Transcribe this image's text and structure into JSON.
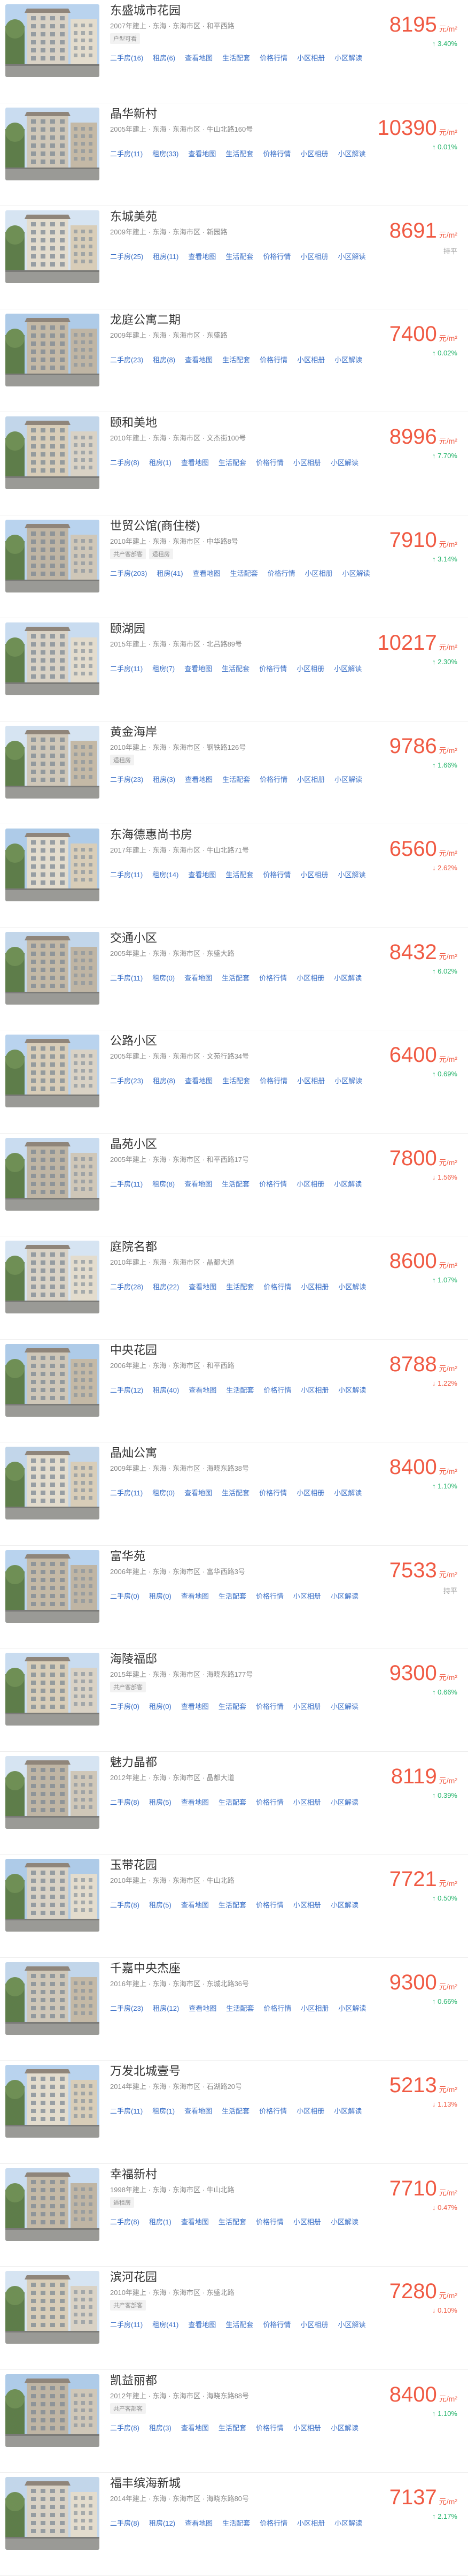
{
  "price_unit": "元/m²",
  "links": [
    "二手房",
    "租房",
    "查看地图",
    "生活配套",
    "价格行情",
    "小区相册",
    "小区解读"
  ],
  "items": [
    {
      "name": "东盛城市花园",
      "meta": "2007年建上 · 东海 · 东海市区 · 和平西路",
      "tags": [
        "户型可看"
      ],
      "sale": "16",
      "rent": "6",
      "price": "8195",
      "change": "↑ 3.40%",
      "dir": "up"
    },
    {
      "name": "晶华新村",
      "meta": "2005年建上 · 东海 · 东海市区 · 牛山北路160号",
      "tags": [],
      "sale": "11",
      "rent": "33",
      "price": "10390",
      "change": "↑ 0.01%",
      "dir": "up"
    },
    {
      "name": "东城美苑",
      "meta": "2009年建上 · 东海 · 东海市区 · 新园路",
      "tags": [],
      "sale": "25",
      "rent": "11",
      "price": "8691",
      "change": "持平",
      "dir": "flat"
    },
    {
      "name": "龙庭公寓二期",
      "meta": "2009年建上 · 东海 · 东海市区 · 东盛路",
      "tags": [],
      "sale": "23",
      "rent": "8",
      "price": "7400",
      "change": "↑ 0.02%",
      "dir": "up"
    },
    {
      "name": "颐和美地",
      "meta": "2010年建上 · 东海 · 东海市区 · 文杰街100号",
      "tags": [],
      "sale": "8",
      "rent": "1",
      "price": "8996",
      "change": "↑ 7.70%",
      "dir": "up"
    },
    {
      "name": "世贸公馆(商住楼)",
      "meta": "2010年建上 · 东海 · 东海市区 · 中华路8号",
      "tags": [
        "共产客部客",
        "适租房"
      ],
      "sale": "203",
      "rent": "41",
      "price": "7910",
      "change": "↑ 3.14%",
      "dir": "up"
    },
    {
      "name": "颐湖园",
      "meta": "2015年建上 · 东海 · 东海市区 · 北吕路89号",
      "tags": [],
      "sale": "11",
      "rent": "7",
      "price": "10217",
      "change": "↑ 2.30%",
      "dir": "up"
    },
    {
      "name": "黄金海岸",
      "meta": "2010年建上 · 东海 · 东海市区 · 钢铁路126号",
      "tags": [
        "适租房"
      ],
      "sale": "23",
      "rent": "3",
      "price": "9786",
      "change": "↑ 1.66%",
      "dir": "up"
    },
    {
      "name": "东海德惠尚书房",
      "meta": "2017年建上 · 东海 · 东海市区 · 牛山北路71号",
      "tags": [],
      "sale": "11",
      "rent": "14",
      "price": "6560",
      "change": "↓ 2.62%",
      "dir": "down"
    },
    {
      "name": "交通小区",
      "meta": "2005年建上 · 东海 · 东海市区 · 东盛大路",
      "tags": [],
      "sale": "11",
      "rent": "0",
      "price": "8432",
      "change": "↑ 6.02%",
      "dir": "up"
    },
    {
      "name": "公路小区",
      "meta": "2005年建上 · 东海 · 东海市区 · 文苑行路34号",
      "tags": [],
      "sale": "23",
      "rent": "8",
      "price": "6400",
      "change": "↑ 0.69%",
      "dir": "up"
    },
    {
      "name": "晶苑小区",
      "meta": "2005年建上 · 东海 · 东海市区 · 和平西路17号",
      "tags": [],
      "sale": "11",
      "rent": "8",
      "price": "7800",
      "change": "↓ 1.56%",
      "dir": "down"
    },
    {
      "name": "庭院名都",
      "meta": "2010年建上 · 东海 · 东海市区 · 晶都大道",
      "tags": [],
      "sale": "28",
      "rent": "22",
      "price": "8600",
      "change": "↑ 1.07%",
      "dir": "up"
    },
    {
      "name": "中央花园",
      "meta": "2006年建上 · 东海 · 东海市区 · 和平西路",
      "tags": [],
      "sale": "12",
      "rent": "40",
      "price": "8788",
      "change": "↓ 1.22%",
      "dir": "down"
    },
    {
      "name": "晶灿公寓",
      "meta": "2009年建上 · 东海 · 东海市区 · 海晓东路38号",
      "tags": [],
      "sale": "11",
      "rent": "0",
      "price": "8400",
      "change": "↑ 1.10%",
      "dir": "up"
    },
    {
      "name": "富华苑",
      "meta": "2006年建上 · 东海 · 东海市区 · 富华西路3号",
      "tags": [],
      "sale": "0",
      "rent": "0",
      "price": "7533",
      "change": "持平",
      "dir": "flat"
    },
    {
      "name": "海陵福邸",
      "meta": "2015年建上 · 东海 · 东海市区 · 海晓东路177号",
      "tags": [
        "共产客部客"
      ],
      "sale": "0",
      "rent": "0",
      "price": "9300",
      "change": "↑ 0.66%",
      "dir": "up"
    },
    {
      "name": "魅力晶都",
      "meta": "2012年建上 · 东海 · 东海市区 · 晶都大道",
      "tags": [],
      "sale": "8",
      "rent": "5",
      "price": "8119",
      "change": "↑ 0.39%",
      "dir": "up"
    },
    {
      "name": "玉带花园",
      "meta": "2010年建上 · 东海 · 东海市区 · 牛山北路",
      "tags": [],
      "sale": "8",
      "rent": "5",
      "price": "7721",
      "change": "↑ 0.50%",
      "dir": "up"
    },
    {
      "name": "千嘉中央杰座",
      "meta": "2016年建上 · 东海 · 东海市区 · 东城北路36号",
      "tags": [],
      "sale": "23",
      "rent": "12",
      "price": "9300",
      "change": "↑ 0.66%",
      "dir": "up"
    },
    {
      "name": "万发北城壹号",
      "meta": "2014年建上 · 东海 · 东海市区 · 石湖路20号",
      "tags": [],
      "sale": "11",
      "rent": "1",
      "price": "5213",
      "change": "↓ 1.13%",
      "dir": "down"
    },
    {
      "name": "幸福新村",
      "meta": "1998年建上 · 东海 · 东海市区 · 牛山北路",
      "tags": [
        "适租房"
      ],
      "sale": "8",
      "rent": "1",
      "price": "7710",
      "change": "↓ 0.47%",
      "dir": "down"
    },
    {
      "name": "滨河花园",
      "meta": "2010年建上 · 东海 · 东海市区 · 东盛北路",
      "tags": [
        "共产客部客"
      ],
      "sale": "11",
      "rent": "41",
      "price": "7280",
      "change": "↓ 0.10%",
      "dir": "down"
    },
    {
      "name": "凯益丽都",
      "meta": "2012年建上 · 东海 · 东海市区 · 海晓东路88号",
      "tags": [
        "共产客部客"
      ],
      "sale": "8",
      "rent": "3",
      "price": "8400",
      "change": "↑ 1.10%",
      "dir": "up"
    },
    {
      "name": "福丰缤海新城",
      "meta": "2014年建上 · 东海 · 东海市区 · 海晓东路80号",
      "tags": [],
      "sale": "8",
      "rent": "12",
      "price": "7137",
      "change": "↑ 2.17%",
      "dir": "up"
    }
  ]
}
